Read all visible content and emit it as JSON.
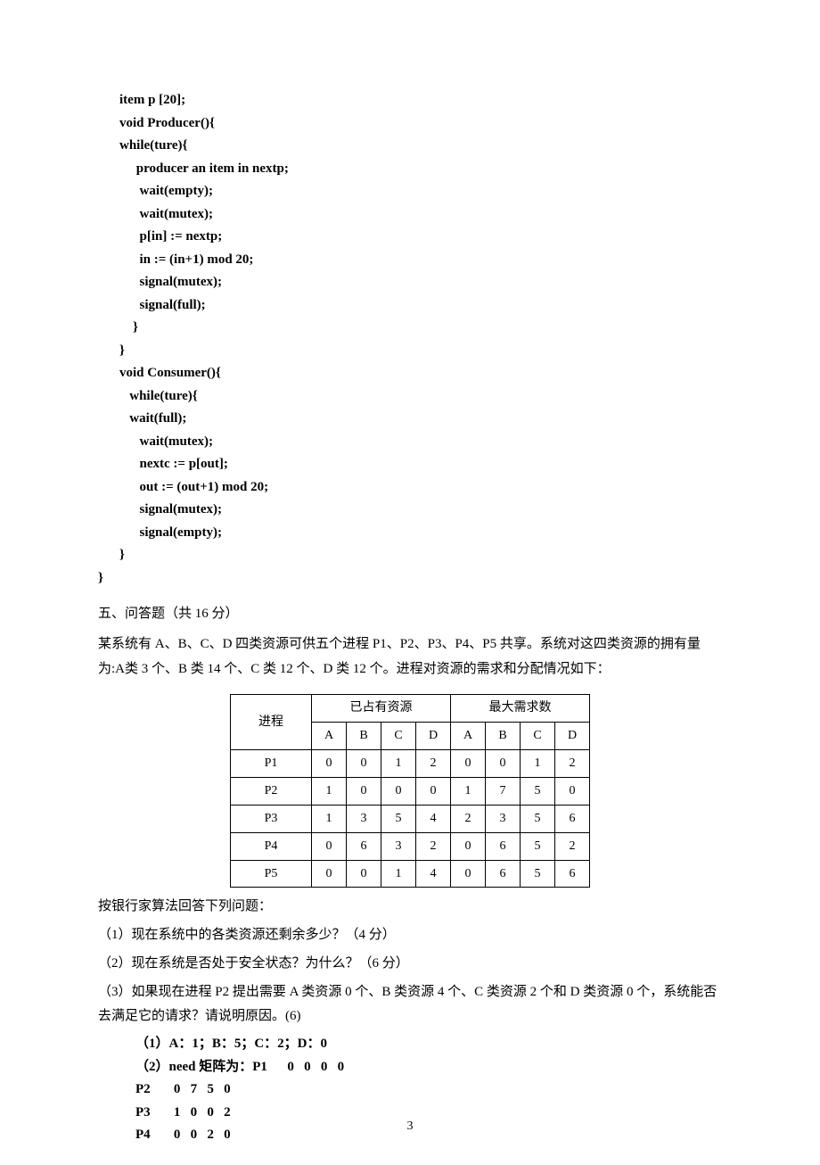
{
  "code": "item p [20];\nvoid Producer(){\nwhile(ture){\n     producer an item in nextp;\n      wait(empty);\n      wait(mutex);\n      p[in] := nextp;\n      in := (in+1) mod 20;\n      signal(mutex);\n      signal(full);\n    }\n}\nvoid Consumer(){\n   while(ture){\n   wait(full);\n      wait(mutex);\n      nextc := p[out];\n      out := (out+1) mod 20;\n      signal(mutex);\n      signal(empty);\n}",
  "code_close": "}",
  "section5_title": "五、问答题（共 16 分）",
  "q_intro1": "某系统有 A、B、C、D 四类资源可供五个进程 P1、P2、P3、P4、P5 共享。系统对这四类资源的拥有量为:A类 3 个、B 类 14 个、C 类 12 个、D 类 12 个。进程对资源的需求和分配情况如下：",
  "table": {
    "h_process": "进程",
    "h_alloc": "已占有资源",
    "h_max": "最大需求数",
    "sub": [
      "A",
      "B",
      "C",
      "D"
    ],
    "rows": [
      {
        "p": "P1",
        "alloc": [
          "0",
          "0",
          "1",
          "2"
        ],
        "max": [
          "0",
          "0",
          "1",
          "2"
        ]
      },
      {
        "p": "P2",
        "alloc": [
          "1",
          "0",
          "0",
          "0"
        ],
        "max": [
          "1",
          "7",
          "5",
          "0"
        ]
      },
      {
        "p": "P3",
        "alloc": [
          "1",
          "3",
          "5",
          "4"
        ],
        "max": [
          "2",
          "3",
          "5",
          "6"
        ]
      },
      {
        "p": "P4",
        "alloc": [
          "0",
          "6",
          "3",
          "2"
        ],
        "max": [
          "0",
          "6",
          "5",
          "2"
        ]
      },
      {
        "p": "P5",
        "alloc": [
          "0",
          "0",
          "1",
          "4"
        ],
        "max": [
          "0",
          "6",
          "5",
          "6"
        ]
      }
    ]
  },
  "bank_intro": "按银行家算法回答下列问题：",
  "q1": "（1）现在系统中的各类资源还剩余多少？（4 分）",
  "q2": "（2）现在系统是否处于安全状态？为什么？（6 分）",
  "q3": "（3）如果现在进程 P2 提出需要 A 类资源 0 个、B 类资源 4 个、C 类资源 2 个和 D 类资源 0 个，系统能否去满足它的请求？请说明原因。(6)",
  "ans": "（1）A：1；B：5；C：2；D：0\n（2）need 矩阵为：P1      0   0   0   0\nP2       0   7   5   0\nP3       1   0   0   2\nP4       0   0   2   0",
  "page_num": "3"
}
